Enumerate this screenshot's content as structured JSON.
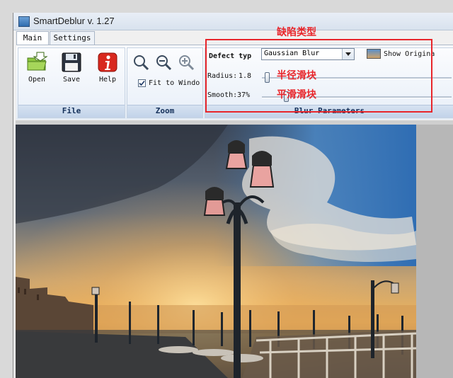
{
  "window": {
    "title": "SmartDeblur v. 1.27"
  },
  "tabs": [
    {
      "label": "Main"
    },
    {
      "label": "Settings"
    }
  ],
  "file_group": {
    "label": "File",
    "buttons": [
      {
        "label": "Open"
      },
      {
        "label": "Save"
      },
      {
        "label": "Help"
      }
    ]
  },
  "zoom_group": {
    "label": "Zoom",
    "fit_label": "Fit to Windo",
    "fit_checked": true
  },
  "blur_group": {
    "label": "Blur Parameters",
    "defect_label": "Defect typ",
    "defect_value": "Gaussian Blur",
    "show_original_label": "Show Origina",
    "radius_label": "Radius:",
    "radius_value": "1.8",
    "smooth_label": "Smooth:",
    "smooth_value": "37%",
    "smooth_level": 0.37
  },
  "annotations": {
    "defect": "缺陷类型",
    "radius": "半径滑块",
    "smooth": "平滑滑块"
  },
  "colors": {
    "annotation": "#e8262b",
    "ribbon_label": "#14305a"
  }
}
